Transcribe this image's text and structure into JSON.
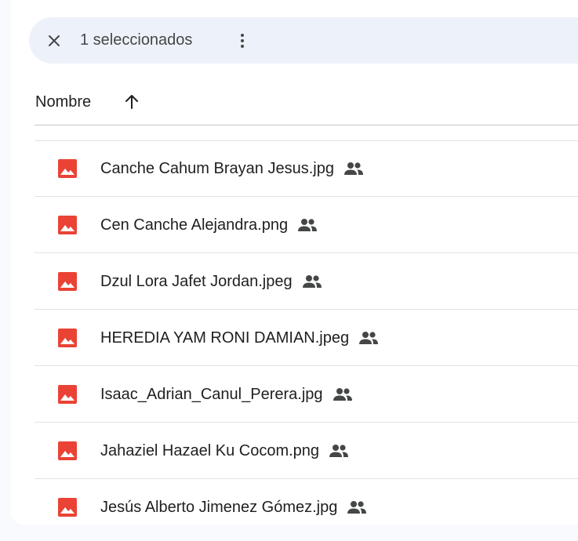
{
  "selection_bar": {
    "close_icon": "close-icon",
    "count_label": "1 seleccionados",
    "more_icon": "more-vert-icon"
  },
  "header": {
    "sort_label": "Nombre",
    "sort_icon": "arrow-up-icon"
  },
  "files": [
    {
      "name": "Canche Cahum Brayan Jesus.jpg",
      "icon": "image-file-icon",
      "shared_icon": "shared-people-icon"
    },
    {
      "name": "Cen Canche Alejandra.png",
      "icon": "image-file-icon",
      "shared_icon": "shared-people-icon"
    },
    {
      "name": "Dzul Lora Jafet Jordan.jpeg",
      "icon": "image-file-icon",
      "shared_icon": "shared-people-icon"
    },
    {
      "name": "HEREDIA YAM RONI DAMIAN.jpeg",
      "icon": "image-file-icon",
      "shared_icon": "shared-people-icon"
    },
    {
      "name": "Isaac_Adrian_Canul_Perera.jpg",
      "icon": "image-file-icon",
      "shared_icon": "shared-people-icon"
    },
    {
      "name": "Jahaziel Hazael Ku Cocom.png",
      "icon": "image-file-icon",
      "shared_icon": "shared-people-icon"
    },
    {
      "name": "Jesús Alberto Jimenez Gómez.jpg",
      "icon": "image-file-icon",
      "shared_icon": "shared-people-icon"
    }
  ],
  "colors": {
    "image_icon": "#ea4335",
    "selection_bar_bg": "#edf2fa",
    "icon_grey": "#444746"
  }
}
